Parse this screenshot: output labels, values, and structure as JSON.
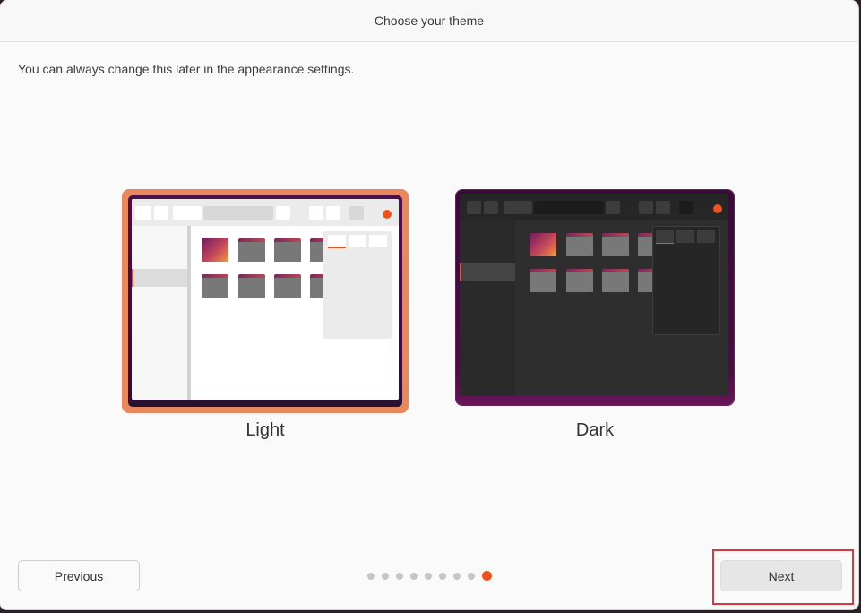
{
  "window": {
    "title": "Choose your theme",
    "subtitle": "You can always change this later in the appearance settings."
  },
  "themes": [
    {
      "label": "Light",
      "selected": true
    },
    {
      "label": "Dark",
      "selected": false
    }
  ],
  "footer": {
    "previous_label": "Previous",
    "next_label": "Next",
    "steps_total": 9,
    "current_step": 9
  },
  "colors": {
    "accent": "#e95420",
    "selection_border": "#e9875d",
    "highlight_box": "#d9363e"
  }
}
